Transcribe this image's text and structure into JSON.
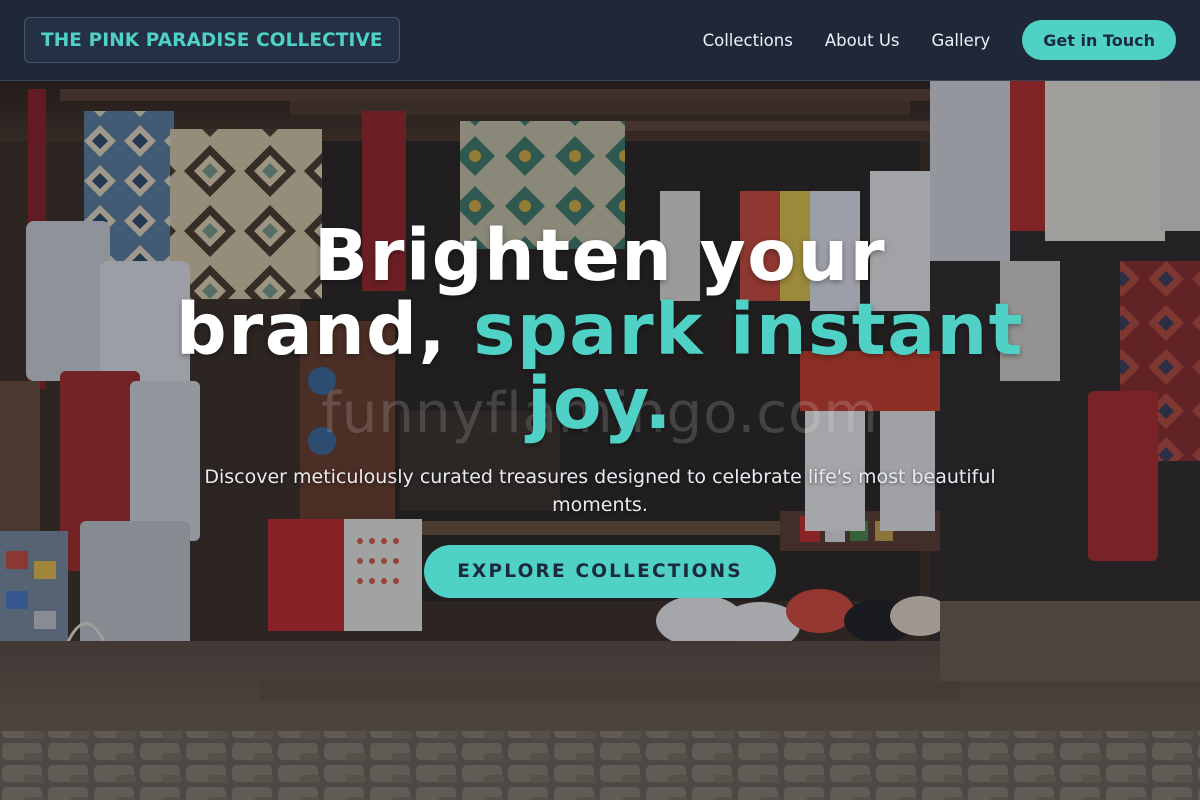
{
  "nav": {
    "brand": "THE PINK PARADISE COLLECTIVE",
    "links": [
      "Collections",
      "About Us",
      "Gallery"
    ],
    "cta": "Get in Touch"
  },
  "hero": {
    "headline_line1": "Brighten your",
    "headline_white2": "brand,",
    "headline_accent2": "spark instant",
    "headline_accent3": "joy.",
    "subtitle": "Discover meticulously curated treasures designed to celebrate life's most beautiful moments.",
    "cta": "EXPLORE COLLECTIONS",
    "watermark": "funnyflamingo.com"
  },
  "colors": {
    "accent": "#4fd1c5",
    "nav_bg": "#1f2838",
    "text_light": "#ffffff"
  }
}
